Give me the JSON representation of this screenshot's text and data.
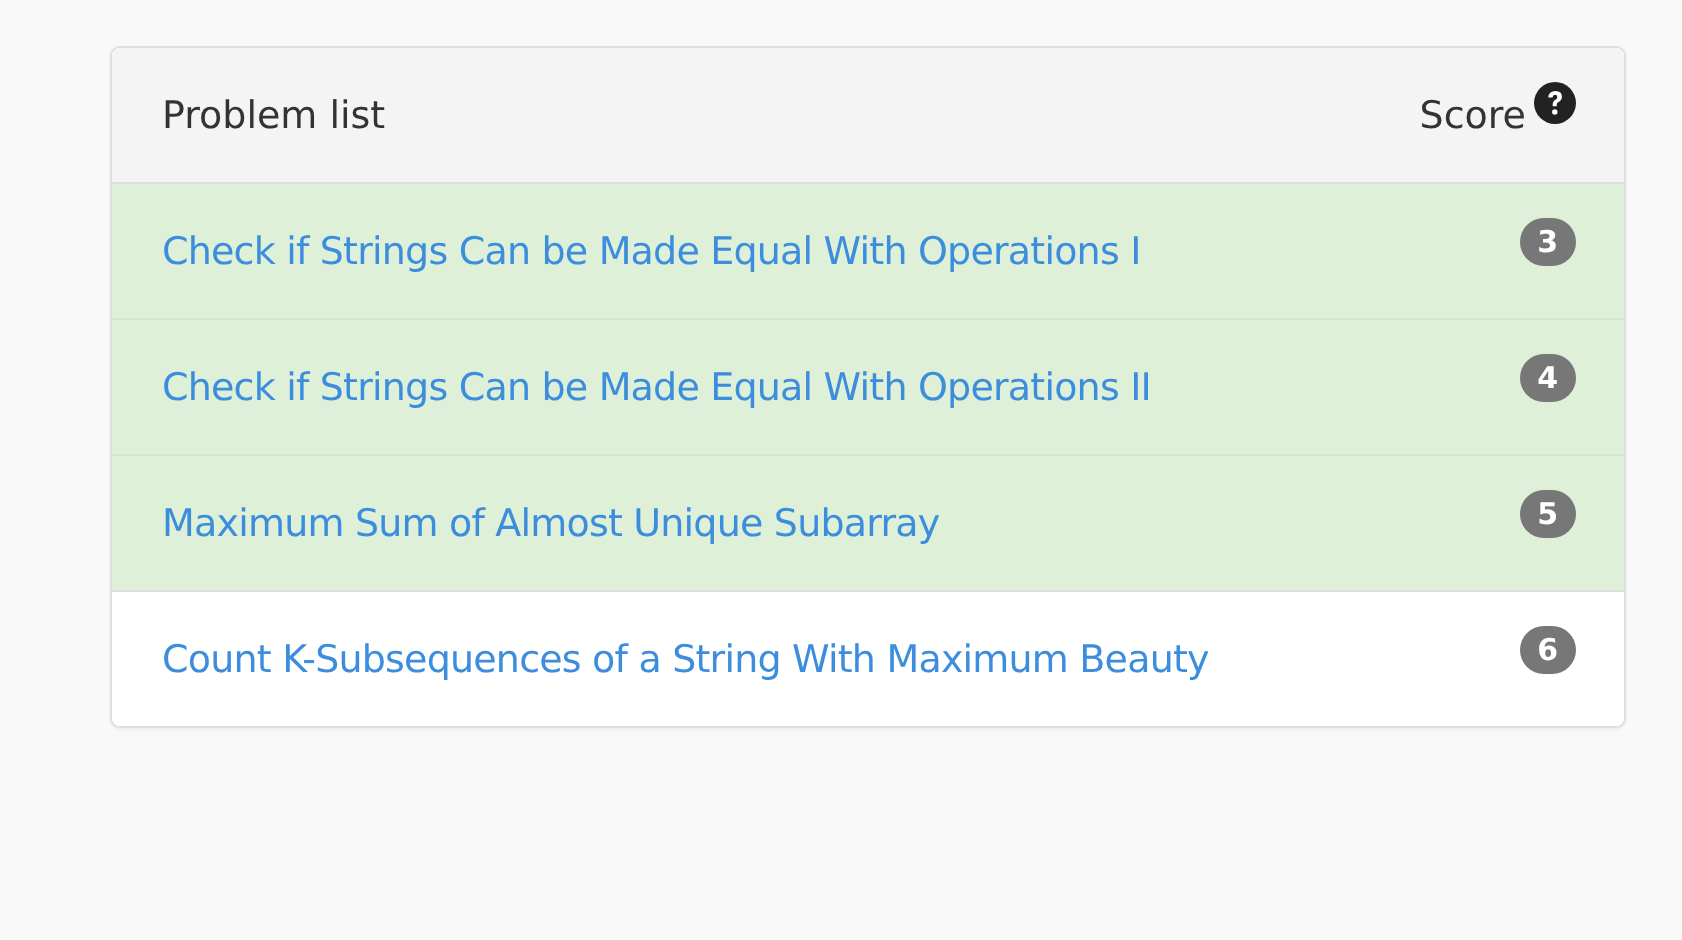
{
  "header": {
    "title": "Problem list",
    "score_label": "Score"
  },
  "problems": [
    {
      "title": "Check if Strings Can be Made Equal With Operations I",
      "score": "3",
      "solved": true
    },
    {
      "title": "Check if Strings Can be Made Equal With Operations II",
      "score": "4",
      "solved": true
    },
    {
      "title": "Maximum Sum of Almost Unique Subarray",
      "score": "5",
      "solved": true
    },
    {
      "title": "Count K-Subsequences of a String With Maximum Beauty",
      "score": "6",
      "solved": false
    }
  ]
}
